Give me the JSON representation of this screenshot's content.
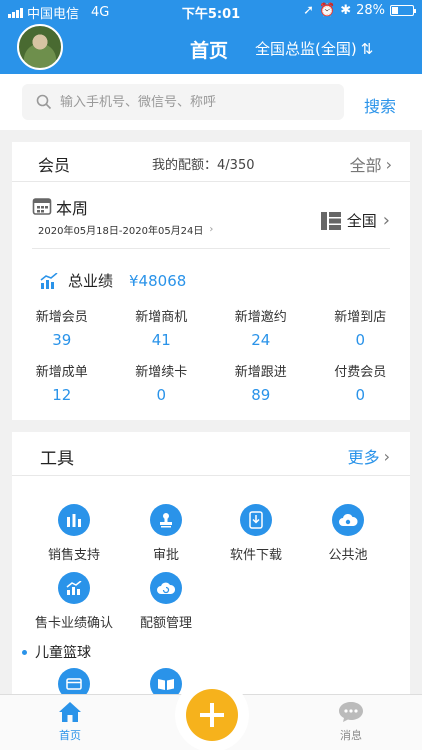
{
  "status_bar": {
    "carrier": "中国电信",
    "network": "4G",
    "time": "下午5:01",
    "battery": "28%",
    "battery_level": 0.28
  },
  "header": {
    "title": "首页",
    "scope": "全国总监(全国)"
  },
  "search": {
    "placeholder": "输入手机号、微信号、称呼",
    "button": "搜索"
  },
  "members": {
    "title": "会员",
    "quota_label": "我的配额：",
    "quota_value": "4/350",
    "all": "全部",
    "week": {
      "label": "本周",
      "range": "2020年05月18日-2020年05月24日",
      "scope": "全国"
    },
    "total_label": "总业绩",
    "total_value": "¥48068",
    "stats": [
      {
        "label": "新增会员",
        "value": "39"
      },
      {
        "label": "新增商机",
        "value": "41"
      },
      {
        "label": "新增邀约",
        "value": "24"
      },
      {
        "label": "新增到店",
        "value": "0"
      },
      {
        "label": "新增成单",
        "value": "12"
      },
      {
        "label": "新增续卡",
        "value": "0"
      },
      {
        "label": "新增跟进",
        "value": "89"
      },
      {
        "label": "付费会员",
        "value": "0"
      }
    ]
  },
  "tools": {
    "title": "工具",
    "more": "更多",
    "items": [
      {
        "label": "销售支持",
        "icon": "bar-chart-icon"
      },
      {
        "label": "审批",
        "icon": "stamp-icon"
      },
      {
        "label": "软件下载",
        "icon": "download-icon"
      },
      {
        "label": "公共池",
        "icon": "cloud-icon"
      },
      {
        "label": "售卡业绩确认",
        "icon": "chart-up-icon"
      },
      {
        "label": "配额管理",
        "icon": "refresh-cloud-icon"
      }
    ],
    "section": "儿童篮球",
    "section_items": [
      {
        "icon": "card-icon"
      },
      {
        "icon": "book-icon"
      }
    ]
  },
  "tabbar": {
    "home": "首页",
    "messages": "消息"
  },
  "colors": {
    "primary": "#2a93e9",
    "fab": "#f6b21c"
  }
}
